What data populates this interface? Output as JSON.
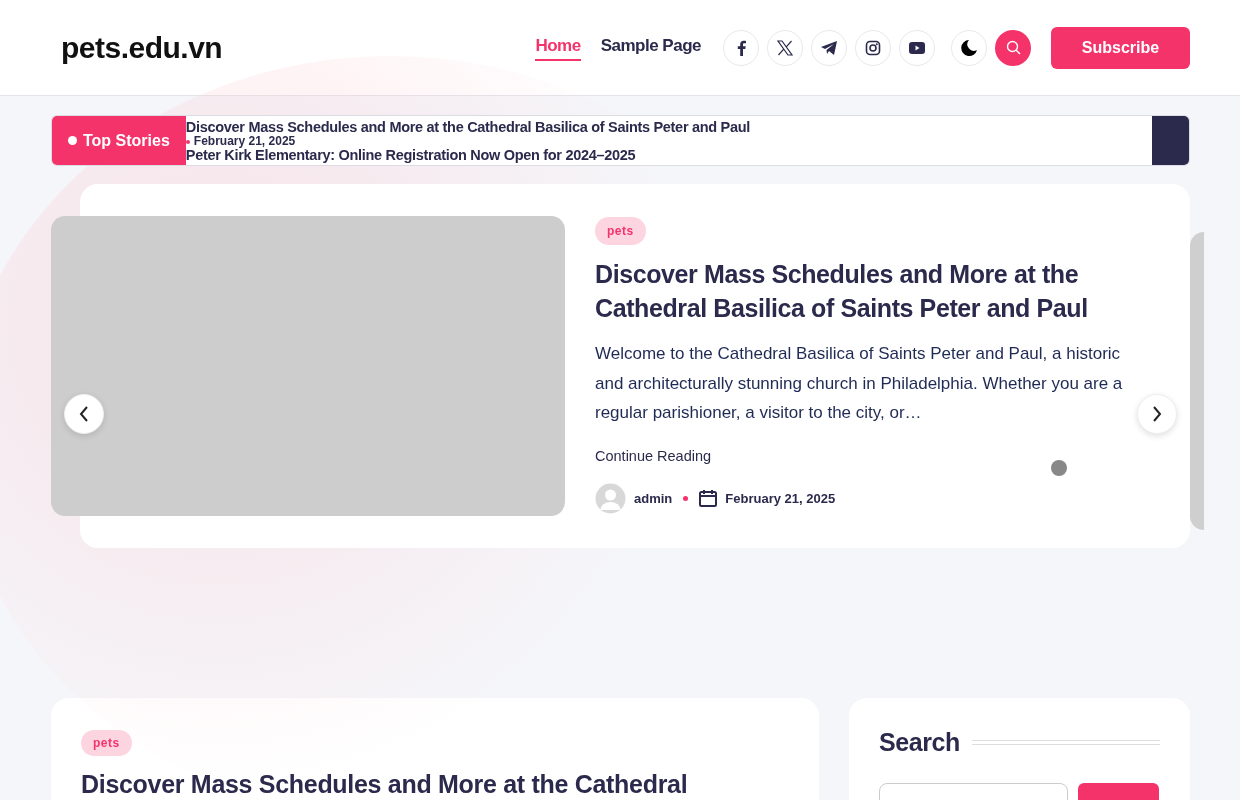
{
  "header": {
    "site_title": "pets.edu.vn",
    "nav": [
      {
        "label": "Home",
        "selected": true
      },
      {
        "label": "Sample Page",
        "selected": false
      }
    ],
    "social": [
      {
        "kind": "facebook"
      },
      {
        "kind": "x"
      },
      {
        "kind": "telegram"
      },
      {
        "kind": "instagram"
      },
      {
        "kind": "youtube"
      }
    ],
    "subscribe": "Subscribe"
  },
  "ticker": {
    "label": "Top Stories",
    "items": [
      {
        "title": "Discover Mass Schedules and More at the Cathedral Basilica of Saints Peter and Paul",
        "date": "February 21, 2025"
      },
      {
        "title": "Peter Kirk Elementary: Online Registration Now Open for 2024–2025"
      }
    ]
  },
  "slide": {
    "category": "pets",
    "title": "Discover Mass Schedules and More at the Cathedral Basilica of Saints Peter and Paul",
    "excerpt": "Welcome to the Cathedral Basilica of Saints Peter and Paul, a historic and architecturally stunning church in Philadelphia. Whether you are a regular parishioner, a visitor to the city, or…",
    "continue": "Continue Reading",
    "author": "admin",
    "date": "February 21, 2025"
  },
  "post": {
    "category": "pets",
    "title": "Discover Mass Schedules and More at the Cathedral"
  },
  "sidebar": {
    "title": "Search"
  }
}
